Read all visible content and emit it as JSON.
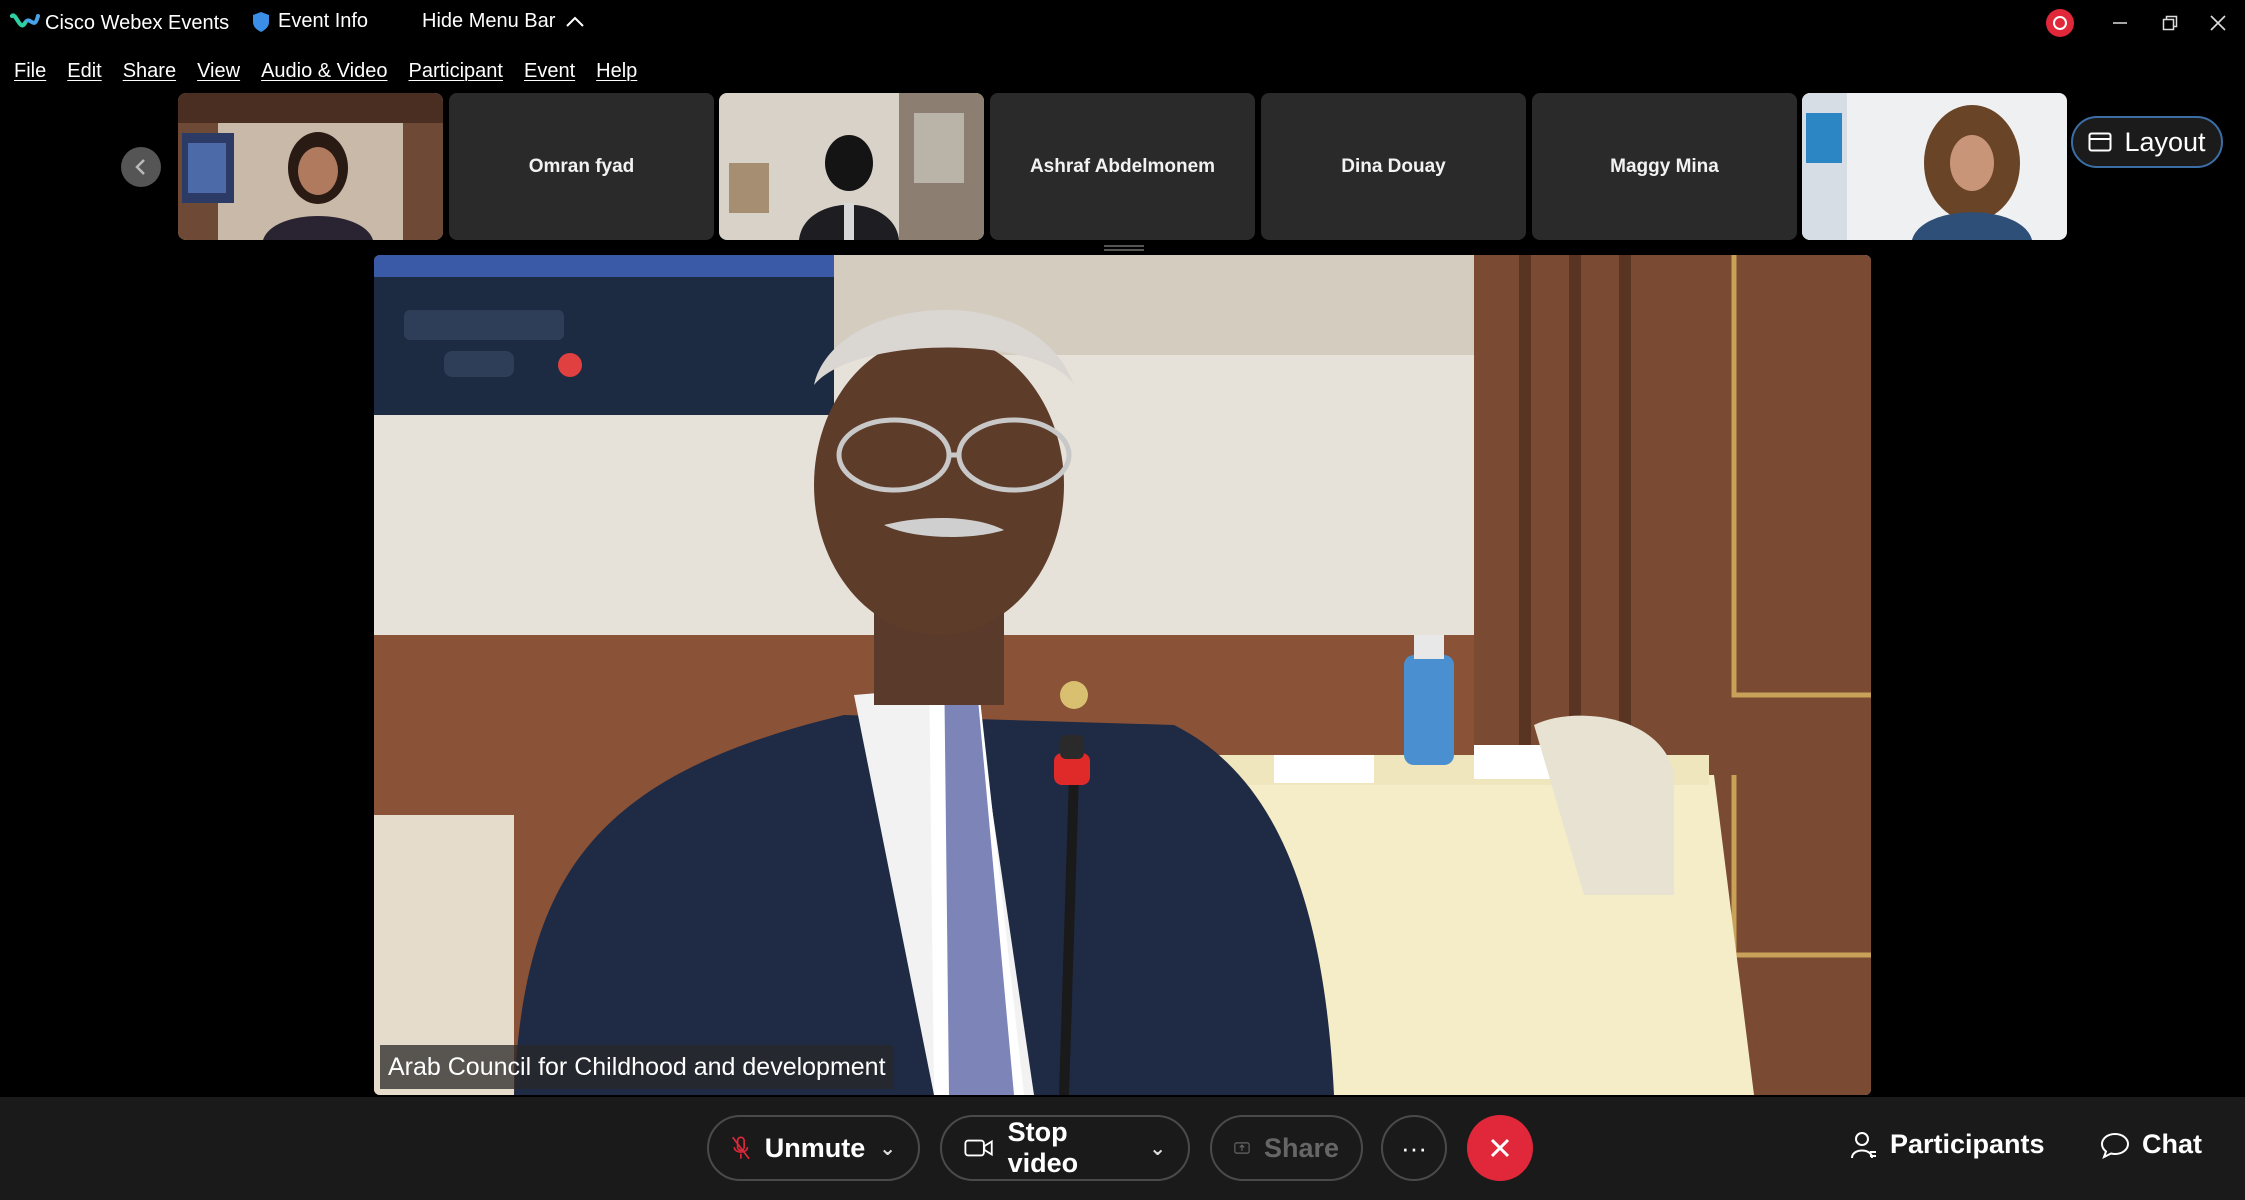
{
  "titlebar": {
    "app_title": "Cisco Webex Events",
    "event_info": "Event Info",
    "hide_menu": "Hide Menu Bar"
  },
  "menu": [
    "File",
    "Edit",
    "Share",
    "View",
    "Audio & Video",
    "Participant",
    "Event",
    "Help"
  ],
  "filmstrip": {
    "tiles": [
      {
        "type": "video",
        "name": ""
      },
      {
        "type": "name",
        "name": "Omran fyad"
      },
      {
        "type": "video",
        "name": ""
      },
      {
        "type": "name",
        "name": "Ashraf Abdelmonem"
      },
      {
        "type": "name",
        "name": "Dina Douay"
      },
      {
        "type": "name",
        "name": "Maggy Mina"
      },
      {
        "type": "video",
        "name": ""
      }
    ],
    "layout_label": "Layout"
  },
  "main_video": {
    "caption": "Arab Council for Childhood and development"
  },
  "controls": {
    "unmute": "Unmute",
    "stop_video": "Stop video",
    "share": "Share",
    "more": "···",
    "participants": "Participants",
    "chat": "Chat"
  },
  "colors": {
    "accent_red": "#e0283a",
    "layout_border": "#3c6ea6",
    "bar_bg": "#1a1a1a"
  }
}
